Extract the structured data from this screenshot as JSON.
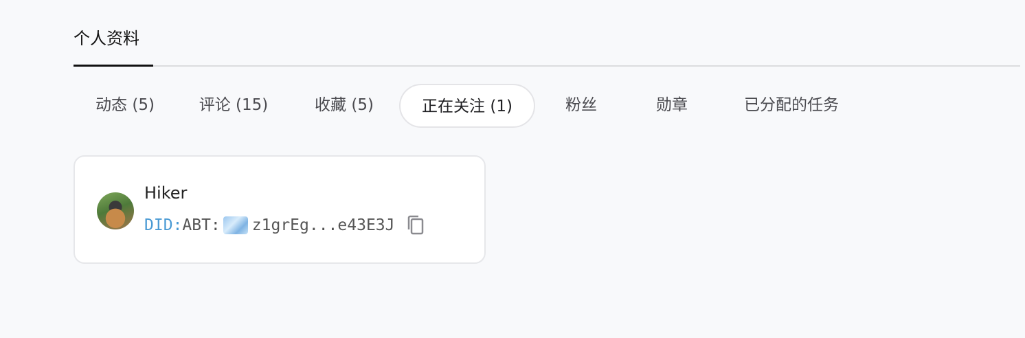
{
  "profile_tabs": [
    {
      "label": "个人资料",
      "active": true
    }
  ],
  "sub_tabs": [
    {
      "label": "动态 (5)",
      "active": false
    },
    {
      "label": "评论 (15)",
      "active": false
    },
    {
      "label": "收藏 (5)",
      "active": false
    },
    {
      "label": "正在关注 (1)",
      "active": true
    },
    {
      "label": "粉丝",
      "active": false
    },
    {
      "label": "勋章",
      "active": false
    },
    {
      "label": "已分配的任务",
      "active": false
    }
  ],
  "following": [
    {
      "name": "Hiker",
      "did_prefix": "DID:",
      "did_type": "ABT:",
      "did_value": "z1grEg...e43E3J"
    }
  ],
  "colors": {
    "background": "#f8f9fb",
    "did_prefix": "#4a9ad4",
    "card_border": "#e6e7ea"
  },
  "icons": {
    "copy": "copy-icon",
    "avatar": "user-avatar",
    "did_badge": "did-badge-icon"
  }
}
